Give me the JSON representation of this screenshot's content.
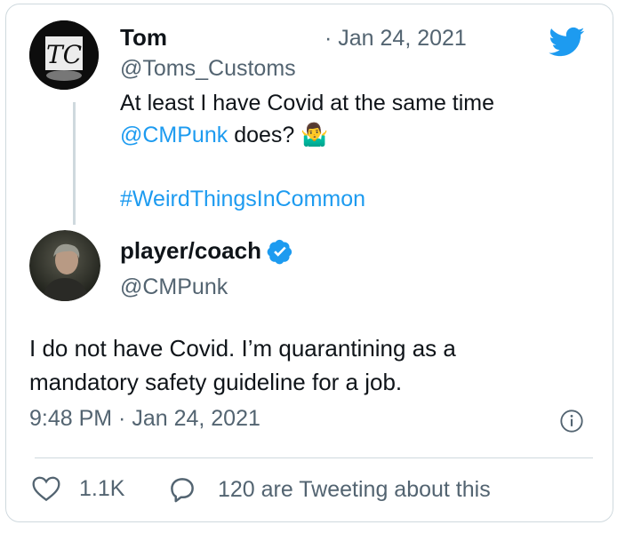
{
  "first_tweet": {
    "name": "Tom",
    "handle": "@Toms_Customs",
    "date": "· Jan 24, 2021",
    "line1": "At least I have Covid at the same time",
    "mention": "@CMPunk",
    "line2_rest": " does?",
    "emoji": "🤷‍♂️",
    "hashtag": "#WeirdThingsInCommon",
    "avatar_text": "TC"
  },
  "reply": {
    "name": "player/coach",
    "handle": "@CMPunk",
    "line1": "I do not have Covid. I’m quarantining as a",
    "line2": "mandatory safety guideline for a job.",
    "timestamp": "9:48 PM · Jan 24, 2021"
  },
  "actions": {
    "likes": "1.1K",
    "tweeting": "120 are Tweeting about this"
  },
  "colors": {
    "twitter_blue": "#1d9bf0",
    "verified_blue": "#1d9bf0",
    "secondary_text": "#536471",
    "border": "#cfd9de"
  },
  "icons": [
    "twitter-bird-icon",
    "verified-badge-icon",
    "info-icon",
    "heart-icon",
    "reply-bubble-icon"
  ]
}
